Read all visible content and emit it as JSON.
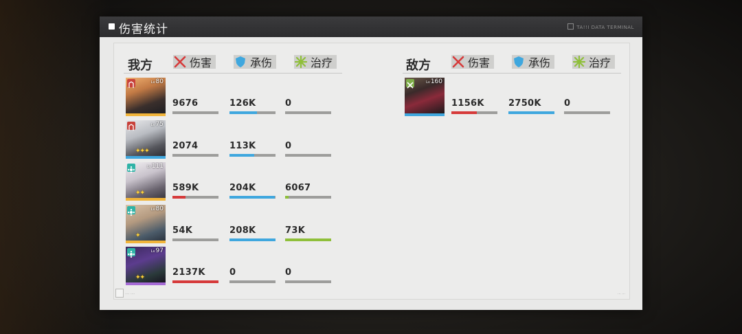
{
  "window": {
    "title": "伤害统计",
    "terminal_label": "TA!!I DATA TERMINAL"
  },
  "colors": {
    "damage": "#d63a3a",
    "taken": "#3fa7de",
    "heal": "#8fbf3a",
    "track": "#9d9d9b"
  },
  "headers": {
    "ally_label": "我方",
    "enemy_label": "敌方",
    "damage_label": "伤害",
    "taken_label": "承伤",
    "heal_label": "治疗"
  },
  "allies": [
    {
      "level": "80",
      "class_icon": "vanguard-icon",
      "stars": "",
      "damage": "9676",
      "damage_fill": 0.0,
      "taken": "126K",
      "taken_fill": 0.6,
      "heal": "0",
      "heal_fill": 0.0
    },
    {
      "level": "75",
      "class_icon": "vanguard-icon",
      "stars": "✦✦✦",
      "damage": "2074",
      "damage_fill": 0.0,
      "taken": "113K",
      "taken_fill": 0.54,
      "heal": "0",
      "heal_fill": 0.0
    },
    {
      "level": "111",
      "class_icon": "medic-icon",
      "stars": "✦✦",
      "damage": "589K",
      "damage_fill": 0.28,
      "taken": "204K",
      "taken_fill": 0.98,
      "heal": "6067",
      "heal_fill": 0.08
    },
    {
      "level": "80",
      "class_icon": "medic-icon",
      "stars": "✦",
      "damage": "54K",
      "damage_fill": 0.0,
      "taken": "208K",
      "taken_fill": 1.0,
      "heal": "73K",
      "heal_fill": 1.0
    },
    {
      "level": "97",
      "class_icon": "medic-icon",
      "stars": "✦✦",
      "damage": "2137K",
      "damage_fill": 1.0,
      "taken": "0",
      "taken_fill": 0.0,
      "heal": "0",
      "heal_fill": 0.0
    }
  ],
  "enemies": [
    {
      "level": "160",
      "class_icon": "enemy-icon",
      "damage": "1156K",
      "damage_fill": 0.55,
      "taken": "2750K",
      "taken_fill": 1.0,
      "heal": "0",
      "heal_fill": 0.0
    }
  ],
  "footer": {
    "left_text": "···· ····",
    "right_text": "··· ···"
  }
}
